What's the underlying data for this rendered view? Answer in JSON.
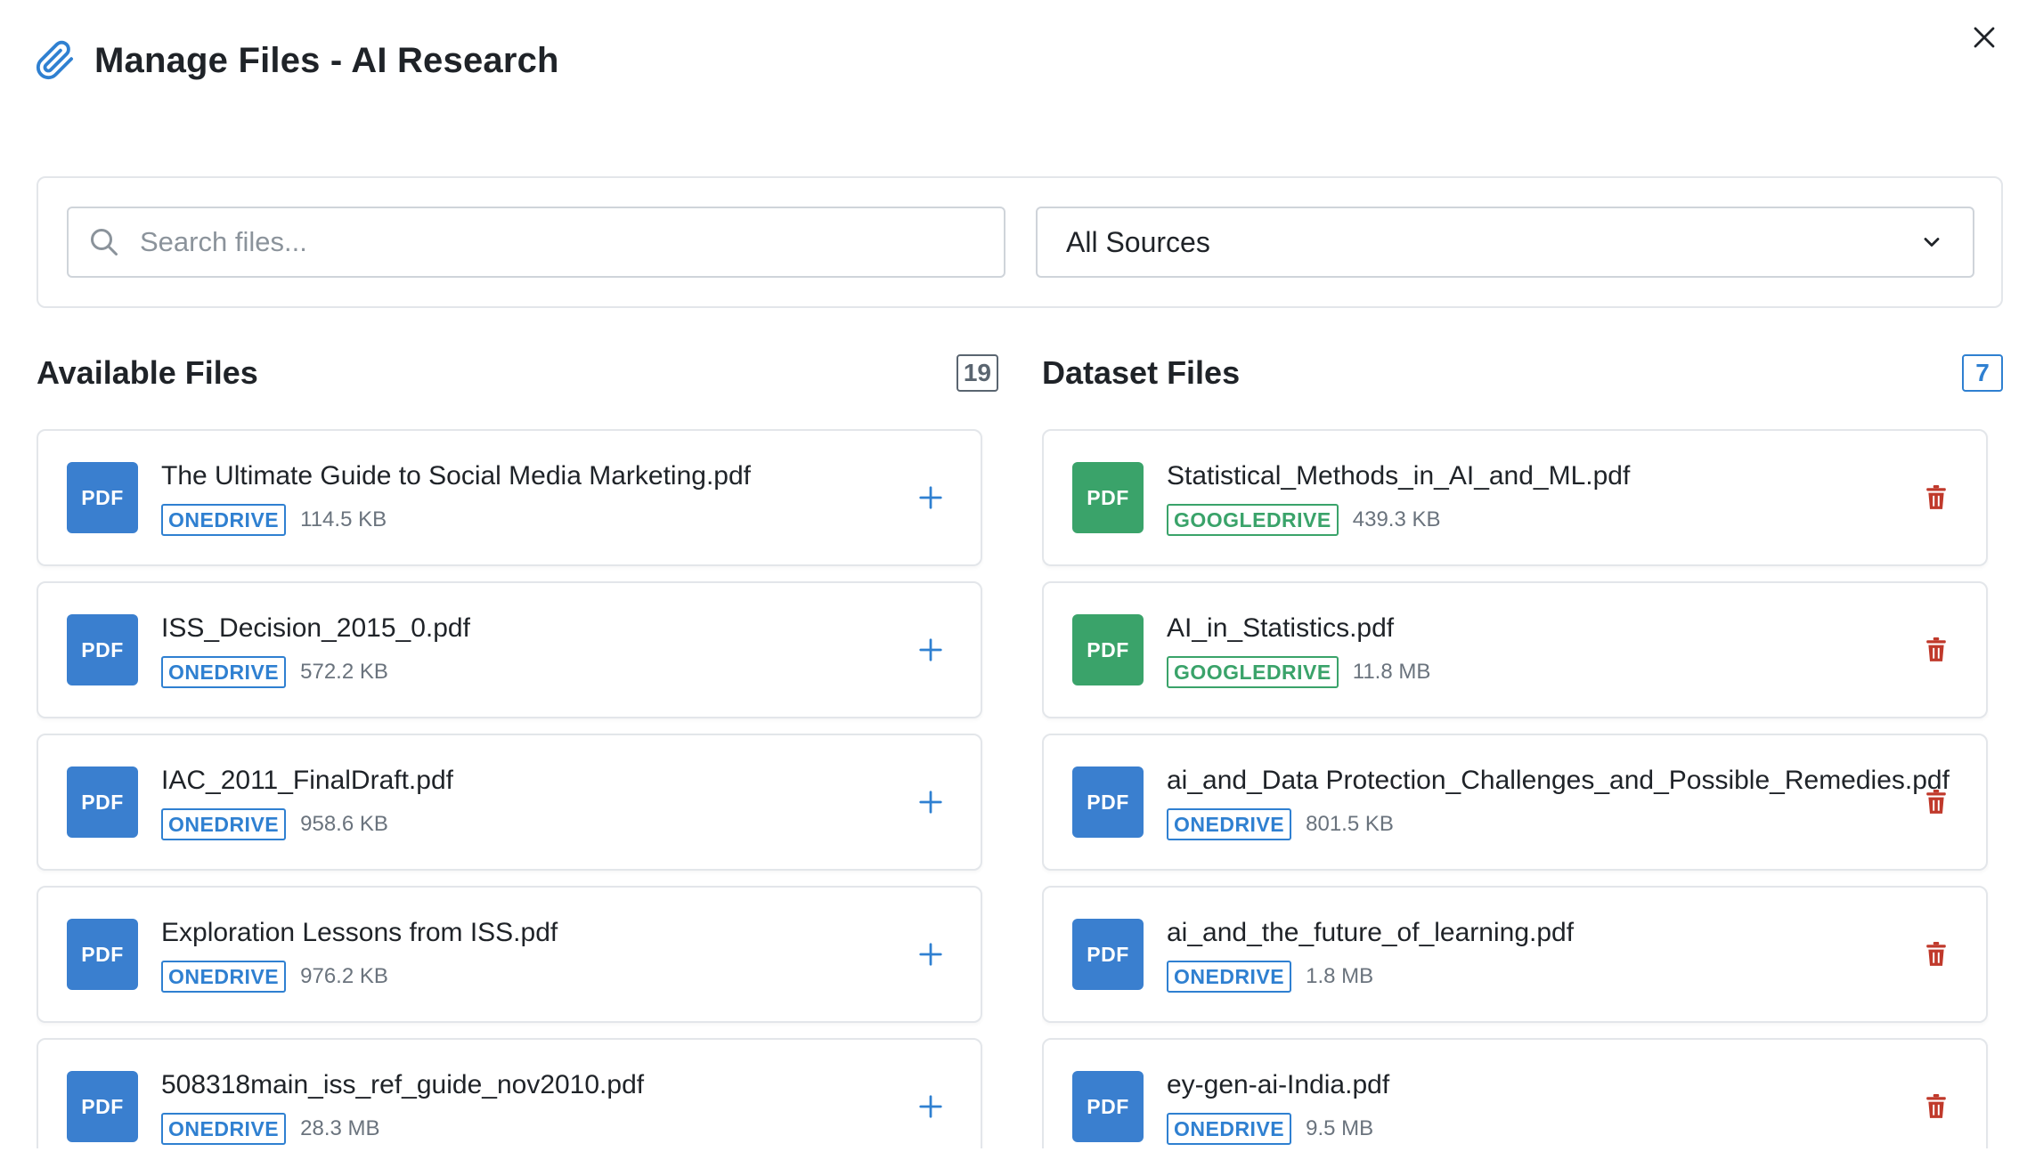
{
  "dialog": {
    "title": "Manage Files - AI Research",
    "icon": "paperclip-icon"
  },
  "filters": {
    "search_placeholder": "Search files...",
    "search_value": "",
    "source_selected": "All Sources"
  },
  "available": {
    "heading": "Available Files",
    "count": "19",
    "files": [
      {
        "name": "The Ultimate Guide to Social Media Marketing.pdf",
        "type": "PDF",
        "source": "ONEDRIVE",
        "size": "114.5 KB"
      },
      {
        "name": "ISS_Decision_2015_0.pdf",
        "type": "PDF",
        "source": "ONEDRIVE",
        "size": "572.2 KB"
      },
      {
        "name": "IAC_2011_FinalDraft.pdf",
        "type": "PDF",
        "source": "ONEDRIVE",
        "size": "958.6 KB"
      },
      {
        "name": "Exploration Lessons from ISS.pdf",
        "type": "PDF",
        "source": "ONEDRIVE",
        "size": "976.2 KB"
      },
      {
        "name": "508318main_iss_ref_guide_nov2010.pdf",
        "type": "PDF",
        "source": "ONEDRIVE",
        "size": "28.3 MB"
      }
    ]
  },
  "dataset": {
    "heading": "Dataset Files",
    "count": "7",
    "files": [
      {
        "name": "Statistical_Methods_in_AI_and_ML.pdf",
        "type": "PDF",
        "source": "GOOGLEDRIVE",
        "size": "439.3 KB"
      },
      {
        "name": "AI_in_Statistics.pdf",
        "type": "PDF",
        "source": "GOOGLEDRIVE",
        "size": "11.8 MB"
      },
      {
        "name": "ai_and_Data Protection_Challenges_and_Possible_Remedies.pdf",
        "type": "PDF",
        "source": "ONEDRIVE",
        "size": "801.5 KB"
      },
      {
        "name": "ai_and_the_future_of_learning.pdf",
        "type": "PDF",
        "source": "ONEDRIVE",
        "size": "1.8 MB"
      },
      {
        "name": "ey-gen-ai-India.pdf",
        "type": "PDF",
        "source": "ONEDRIVE",
        "size": "9.5 MB"
      }
    ]
  },
  "colors": {
    "accent_blue": "#2f80d1",
    "pdf_blue": "#3a7fcf",
    "pdf_green": "#3aa36a",
    "delete_red": "#c0392b"
  }
}
